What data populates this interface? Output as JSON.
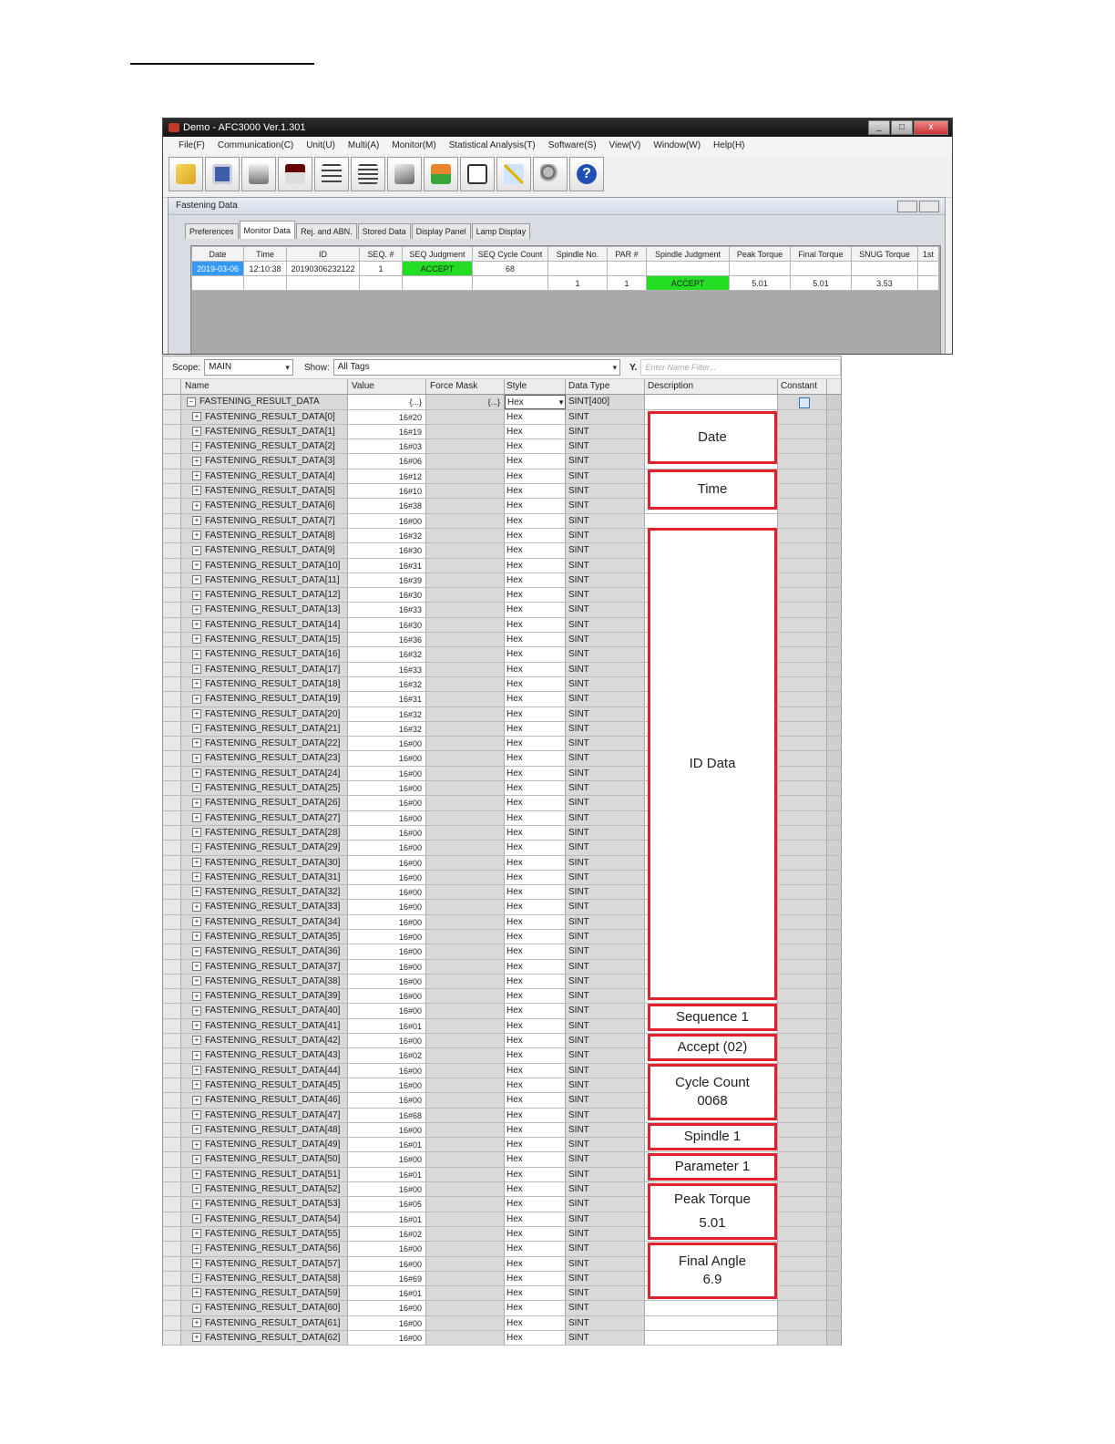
{
  "window": {
    "title": "Demo - AFC3000 Ver.1.301",
    "controls": [
      "_",
      "□",
      "x"
    ],
    "menu": [
      "File(F)",
      "Communication(C)",
      "Unit(U)",
      "Multi(A)",
      "Monitor(M)",
      "Statistical Analysis(T)",
      "Software(S)",
      "View(V)",
      "Window(W)",
      "Help(H)"
    ],
    "toolbar_icons": [
      "folder-open-icon",
      "save-icon",
      "printer-icon",
      "meter-icon",
      "settings-list-icon",
      "tree-list-icon",
      "scanner-icon",
      "transfer-icon",
      "document-icon",
      "chart-icon",
      "key-icon",
      "help-icon"
    ],
    "child": {
      "title": "Fastening Data",
      "tabs": [
        "Preferences",
        "Monitor Data",
        "Rej. and ABN.",
        "Stored Data",
        "Display Panel",
        "Lamp Display"
      ],
      "active_tab": "Monitor Data",
      "columns": [
        "Date",
        "Time",
        "ID",
        "SEQ. #",
        "SEQ Judgment",
        "SEQ Cycle Count",
        "Spindle No.",
        "PAR #",
        "Spindle Judgment",
        "Peak Torque",
        "Final Torque",
        "SNUG  Torque",
        "1st"
      ],
      "row1": {
        "date": "2019-03-06",
        "time": "12:10:38",
        "id": "20190306232122",
        "seq": "1",
        "seq_judgment": "ACCEPT",
        "seq_cycle_count": "68"
      },
      "row2": {
        "spindle_no": "1",
        "par": "1",
        "spindle_judgment": "ACCEPT",
        "peak_torque": "5.01",
        "final_torque": "5.01",
        "snug_torque": "3.53"
      }
    }
  },
  "tag_browser": {
    "scope_label": "Scope:",
    "scope_value": "MAIN",
    "show_label": "Show:",
    "show_value": "All Tags",
    "filter_placeholder": "Enter Name Filter...",
    "columns": {
      "name": "Name",
      "value": "Value",
      "force_mask": "Force Mask",
      "style": "Style",
      "data_type": "Data Type",
      "description": "Description",
      "constant": "Constant"
    },
    "parent": {
      "name": "FASTENING_RESULT_DATA",
      "value": "{...}",
      "force_mask": "{...}",
      "style": "Hex",
      "data_type": "SINT[400]"
    },
    "rows": [
      {
        "name": "FASTENING_RESULT_DATA[0]",
        "value": "16#20",
        "style": "Hex",
        "type": "SINT"
      },
      {
        "name": "FASTENING_RESULT_DATA[1]",
        "value": "16#19",
        "style": "Hex",
        "type": "SINT"
      },
      {
        "name": "FASTENING_RESULT_DATA[2]",
        "value": "16#03",
        "style": "Hex",
        "type": "SINT"
      },
      {
        "name": "FASTENING_RESULT_DATA[3]",
        "value": "16#06",
        "style": "Hex",
        "type": "SINT"
      },
      {
        "name": "FASTENING_RESULT_DATA[4]",
        "value": "16#12",
        "style": "Hex",
        "type": "SINT"
      },
      {
        "name": "FASTENING_RESULT_DATA[5]",
        "value": "16#10",
        "style": "Hex",
        "type": "SINT"
      },
      {
        "name": "FASTENING_RESULT_DATA[6]",
        "value": "16#38",
        "style": "Hex",
        "type": "SINT"
      },
      {
        "name": "FASTENING_RESULT_DATA[7]",
        "value": "16#00",
        "style": "Hex",
        "type": "SINT"
      },
      {
        "name": "FASTENING_RESULT_DATA[8]",
        "value": "16#32",
        "style": "Hex",
        "type": "SINT"
      },
      {
        "name": "FASTENING_RESULT_DATA[9]",
        "value": "16#30",
        "style": "Hex",
        "type": "SINT"
      },
      {
        "name": "FASTENING_RESULT_DATA[10]",
        "value": "16#31",
        "style": "Hex",
        "type": "SINT"
      },
      {
        "name": "FASTENING_RESULT_DATA[11]",
        "value": "16#39",
        "style": "Hex",
        "type": "SINT"
      },
      {
        "name": "FASTENING_RESULT_DATA[12]",
        "value": "16#30",
        "style": "Hex",
        "type": "SINT"
      },
      {
        "name": "FASTENING_RESULT_DATA[13]",
        "value": "16#33",
        "style": "Hex",
        "type": "SINT"
      },
      {
        "name": "FASTENING_RESULT_DATA[14]",
        "value": "16#30",
        "style": "Hex",
        "type": "SINT"
      },
      {
        "name": "FASTENING_RESULT_DATA[15]",
        "value": "16#36",
        "style": "Hex",
        "type": "SINT"
      },
      {
        "name": "FASTENING_RESULT_DATA[16]",
        "value": "16#32",
        "style": "Hex",
        "type": "SINT"
      },
      {
        "name": "FASTENING_RESULT_DATA[17]",
        "value": "16#33",
        "style": "Hex",
        "type": "SINT"
      },
      {
        "name": "FASTENING_RESULT_DATA[18]",
        "value": "16#32",
        "style": "Hex",
        "type": "SINT"
      },
      {
        "name": "FASTENING_RESULT_DATA[19]",
        "value": "16#31",
        "style": "Hex",
        "type": "SINT"
      },
      {
        "name": "FASTENING_RESULT_DATA[20]",
        "value": "16#32",
        "style": "Hex",
        "type": "SINT"
      },
      {
        "name": "FASTENING_RESULT_DATA[21]",
        "value": "16#32",
        "style": "Hex",
        "type": "SINT"
      },
      {
        "name": "FASTENING_RESULT_DATA[22]",
        "value": "16#00",
        "style": "Hex",
        "type": "SINT"
      },
      {
        "name": "FASTENING_RESULT_DATA[23]",
        "value": "16#00",
        "style": "Hex",
        "type": "SINT"
      },
      {
        "name": "FASTENING_RESULT_DATA[24]",
        "value": "16#00",
        "style": "Hex",
        "type": "SINT"
      },
      {
        "name": "FASTENING_RESULT_DATA[25]",
        "value": "16#00",
        "style": "Hex",
        "type": "SINT"
      },
      {
        "name": "FASTENING_RESULT_DATA[26]",
        "value": "16#00",
        "style": "Hex",
        "type": "SINT"
      },
      {
        "name": "FASTENING_RESULT_DATA[27]",
        "value": "16#00",
        "style": "Hex",
        "type": "SINT"
      },
      {
        "name": "FASTENING_RESULT_DATA[28]",
        "value": "16#00",
        "style": "Hex",
        "type": "SINT"
      },
      {
        "name": "FASTENING_RESULT_DATA[29]",
        "value": "16#00",
        "style": "Hex",
        "type": "SINT"
      },
      {
        "name": "FASTENING_RESULT_DATA[30]",
        "value": "16#00",
        "style": "Hex",
        "type": "SINT"
      },
      {
        "name": "FASTENING_RESULT_DATA[31]",
        "value": "16#00",
        "style": "Hex",
        "type": "SINT"
      },
      {
        "name": "FASTENING_RESULT_DATA[32]",
        "value": "16#00",
        "style": "Hex",
        "type": "SINT"
      },
      {
        "name": "FASTENING_RESULT_DATA[33]",
        "value": "16#00",
        "style": "Hex",
        "type": "SINT"
      },
      {
        "name": "FASTENING_RESULT_DATA[34]",
        "value": "16#00",
        "style": "Hex",
        "type": "SINT"
      },
      {
        "name": "FASTENING_RESULT_DATA[35]",
        "value": "16#00",
        "style": "Hex",
        "type": "SINT"
      },
      {
        "name": "FASTENING_RESULT_DATA[36]",
        "value": "16#00",
        "style": "Hex",
        "type": "SINT"
      },
      {
        "name": "FASTENING_RESULT_DATA[37]",
        "value": "16#00",
        "style": "Hex",
        "type": "SINT"
      },
      {
        "name": "FASTENING_RESULT_DATA[38]",
        "value": "16#00",
        "style": "Hex",
        "type": "SINT"
      },
      {
        "name": "FASTENING_RESULT_DATA[39]",
        "value": "16#00",
        "style": "Hex",
        "type": "SINT"
      },
      {
        "name": "FASTENING_RESULT_DATA[40]",
        "value": "16#00",
        "style": "Hex",
        "type": "SINT"
      },
      {
        "name": "FASTENING_RESULT_DATA[41]",
        "value": "16#01",
        "style": "Hex",
        "type": "SINT"
      },
      {
        "name": "FASTENING_RESULT_DATA[42]",
        "value": "16#00",
        "style": "Hex",
        "type": "SINT"
      },
      {
        "name": "FASTENING_RESULT_DATA[43]",
        "value": "16#02",
        "style": "Hex",
        "type": "SINT"
      },
      {
        "name": "FASTENING_RESULT_DATA[44]",
        "value": "16#00",
        "style": "Hex",
        "type": "SINT"
      },
      {
        "name": "FASTENING_RESULT_DATA[45]",
        "value": "16#00",
        "style": "Hex",
        "type": "SINT"
      },
      {
        "name": "FASTENING_RESULT_DATA[46]",
        "value": "16#00",
        "style": "Hex",
        "type": "SINT"
      },
      {
        "name": "FASTENING_RESULT_DATA[47]",
        "value": "16#68",
        "style": "Hex",
        "type": "SINT"
      },
      {
        "name": "FASTENING_RESULT_DATA[48]",
        "value": "16#00",
        "style": "Hex",
        "type": "SINT"
      },
      {
        "name": "FASTENING_RESULT_DATA[49]",
        "value": "16#01",
        "style": "Hex",
        "type": "SINT"
      },
      {
        "name": "FASTENING_RESULT_DATA[50]",
        "value": "16#00",
        "style": "Hex",
        "type": "SINT"
      },
      {
        "name": "FASTENING_RESULT_DATA[51]",
        "value": "16#01",
        "style": "Hex",
        "type": "SINT"
      },
      {
        "name": "FASTENING_RESULT_DATA[52]",
        "value": "16#00",
        "style": "Hex",
        "type": "SINT"
      },
      {
        "name": "FASTENING_RESULT_DATA[53]",
        "value": "16#05",
        "style": "Hex",
        "type": "SINT"
      },
      {
        "name": "FASTENING_RESULT_DATA[54]",
        "value": "16#01",
        "style": "Hex",
        "type": "SINT"
      },
      {
        "name": "FASTENING_RESULT_DATA[55]",
        "value": "16#02",
        "style": "Hex",
        "type": "SINT"
      },
      {
        "name": "FASTENING_RESULT_DATA[56]",
        "value": "16#00",
        "style": "Hex",
        "type": "SINT"
      },
      {
        "name": "FASTENING_RESULT_DATA[57]",
        "value": "16#00",
        "style": "Hex",
        "type": "SINT"
      },
      {
        "name": "FASTENING_RESULT_DATA[58]",
        "value": "16#69",
        "style": "Hex",
        "type": "SINT"
      },
      {
        "name": "FASTENING_RESULT_DATA[59]",
        "value": "16#01",
        "style": "Hex",
        "type": "SINT"
      },
      {
        "name": "FASTENING_RESULT_DATA[60]",
        "value": "16#00",
        "style": "Hex",
        "type": "SINT"
      },
      {
        "name": "FASTENING_RESULT_DATA[61]",
        "value": "16#00",
        "style": "Hex",
        "type": "SINT"
      },
      {
        "name": "FASTENING_RESULT_DATA[62]",
        "value": "16#00",
        "style": "Hex",
        "type": "SINT"
      }
    ]
  },
  "annotations": {
    "date": "Date",
    "time": "Time",
    "id_data": "ID Data",
    "sequence": "Sequence 1",
    "accept": "Accept (02)",
    "cycle_count": [
      "Cycle Count",
      "0068"
    ],
    "spindle": "Spindle 1",
    "parameter": "Parameter 1",
    "peak_torque": [
      "Peak Torque",
      "5.01"
    ],
    "final_angle": [
      "Final Angle",
      "6.9"
    ]
  },
  "colors": {
    "accept_green": "#22dd22",
    "annotation_red": "#e4202e",
    "selection_blue": "#3399ff"
  }
}
